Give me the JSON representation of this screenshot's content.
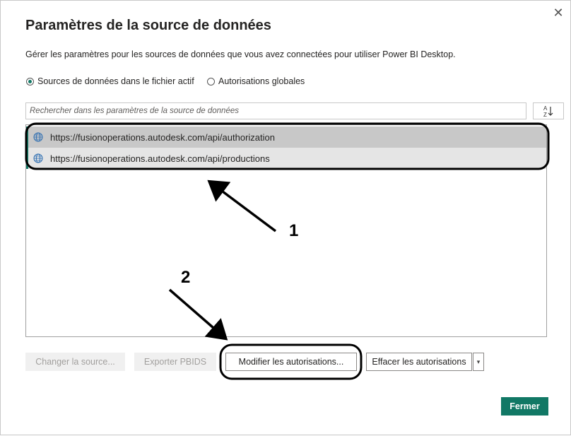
{
  "dialog": {
    "title": "Paramètres de la source de données",
    "description": "Gérer les paramètres pour les sources de données que vous avez connectées pour utiliser Power BI Desktop.",
    "close_glyph": "✕"
  },
  "scope": {
    "options": [
      {
        "label": "Sources de données dans le fichier actif",
        "selected": true
      },
      {
        "label": "Autorisations globales",
        "selected": false
      }
    ]
  },
  "search": {
    "placeholder": "Rechercher dans les paramètres de la source de données",
    "value": ""
  },
  "sort": {
    "icon": "sort-az-icon"
  },
  "sources": [
    {
      "url": "https://fusionoperations.autodesk.com/api/authorization",
      "icon": "globe-icon",
      "selected": true
    },
    {
      "url": "https://fusionoperations.autodesk.com/api/productions",
      "icon": "globe-icon",
      "selected": false
    }
  ],
  "actions": {
    "change_source": "Changer la source...",
    "export_pbids": "Exporter PBIDS",
    "edit_permissions": "Modifier les autorisations...",
    "clear_permissions": "Effacer les autorisations",
    "close": "Fermer"
  },
  "annotations": {
    "label_1": "1",
    "label_2": "2"
  },
  "colors": {
    "accent": "#117865",
    "selected_row": "#c8c8c8",
    "hover_row": "#e5e5e5",
    "disabled_button": "#f0f0f0"
  }
}
